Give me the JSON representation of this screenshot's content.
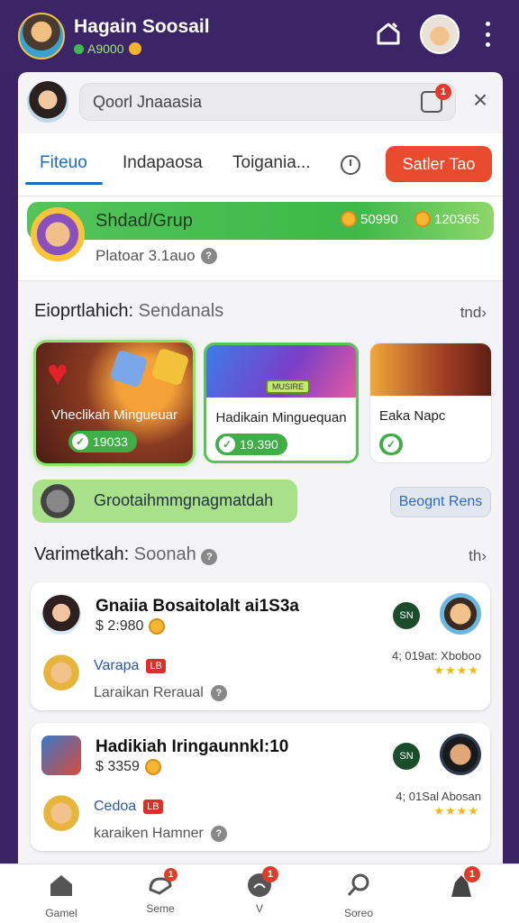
{
  "header": {
    "username": "Hagain Soosail",
    "balance": "A9000"
  },
  "search": {
    "value": "Qoorl Jnaaasia",
    "notif_count": "1"
  },
  "tabs": {
    "items": [
      "Fiteuo",
      "Indapaosa",
      "Toigania..."
    ],
    "active_index": 0,
    "start_label": "Satler Tao"
  },
  "group": {
    "title": "Shdad/Grup",
    "coins_a": "50990",
    "coins_b": "120365",
    "subtitle": "Platoar 3.1auo"
  },
  "featured": {
    "heading": "Eioprtlahich:",
    "heading_light": "Sendanals",
    "more": "tnd",
    "games": [
      {
        "title": "Vheclikah Mingueuar",
        "amount": "19033"
      },
      {
        "title": "Hadikain Minguequan",
        "amount": "19.390",
        "tag": "MUSIRE"
      },
      {
        "title": "Eaka Napc",
        "amount": ""
      }
    ]
  },
  "banner": {
    "text": "Grootaihmmgnagmatdah",
    "button": "Beognt Rens"
  },
  "list": {
    "heading": "Varimetkah:",
    "heading_light": "Soonah",
    "more": "th",
    "rows": [
      {
        "title": "Gnaiia Bosaitolalt ai1S3a",
        "amount": "$ 2:980",
        "player": "Varapa",
        "level": "LB",
        "footer": "Laraikan Reraual",
        "sn": "SN",
        "score": "4; 019at: Xboboo",
        "stars": "★★★★"
      },
      {
        "title": "Hadikiah Iringaunnkl:10",
        "amount": "$ 3359",
        "player": "Cedoa",
        "level": "LB",
        "footer": "karaiken Hamner",
        "sn": "SN",
        "score": "4; 01Sal Abosan",
        "stars": "★★★★"
      }
    ]
  },
  "nav": {
    "items": [
      {
        "label": "Gamel",
        "icon": "home-icon",
        "badge": ""
      },
      {
        "label": "Seme",
        "icon": "chat-icon",
        "badge": "1"
      },
      {
        "label": "V",
        "icon": "bell-icon",
        "badge": "1"
      },
      {
        "label": "Soreo",
        "icon": "search-icon",
        "badge": ""
      },
      {
        "label": "",
        "icon": "profile-icon",
        "badge": "1"
      }
    ]
  },
  "colors": {
    "app_bar": "#3b2566",
    "accent": "#1e6ac8",
    "cta": "#ea4a2e",
    "green": "#3fae46"
  }
}
